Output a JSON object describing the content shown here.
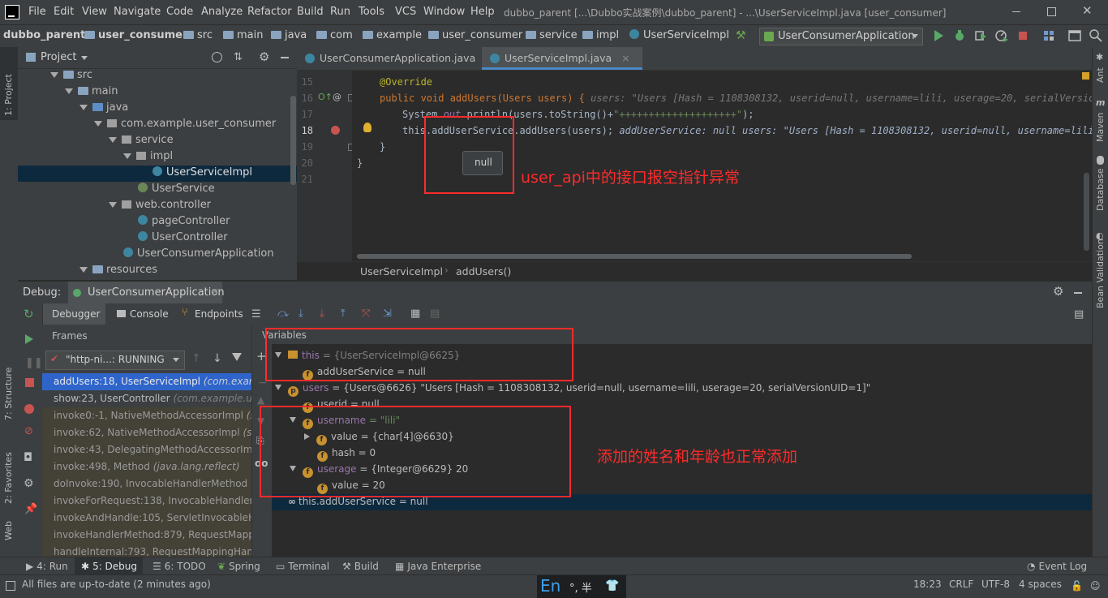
{
  "menu": {
    "items": [
      "File",
      "Edit",
      "View",
      "Navigate",
      "Code",
      "Analyze",
      "Refactor",
      "Build",
      "Run",
      "Tools",
      "VCS",
      "Window",
      "Help"
    ],
    "window_title": "dubbo_parent [...\\Dubbo实战案例\\dubbo_parent] - ...\\UserServiceImpl.java [user_consumer]"
  },
  "breadcrumbs": [
    "dubbo_parent",
    "user_consumer",
    "src",
    "main",
    "java",
    "com",
    "example",
    "user_consumer",
    "service",
    "impl",
    "UserServiceImpl"
  ],
  "run_config": "UserConsumerApplication",
  "project": {
    "title": "Project",
    "tree": [
      {
        "label": "src",
        "type": "folder"
      },
      {
        "label": "main",
        "type": "folder"
      },
      {
        "label": "java",
        "type": "folder"
      },
      {
        "label": "com.example.user_consumer",
        "type": "package"
      },
      {
        "label": "service",
        "type": "package"
      },
      {
        "label": "impl",
        "type": "package"
      },
      {
        "label": "UserServiceImpl",
        "type": "class"
      },
      {
        "label": "UserService",
        "type": "interface"
      },
      {
        "label": "web.controller",
        "type": "package"
      },
      {
        "label": "pageController",
        "type": "class"
      },
      {
        "label": "UserController",
        "type": "class"
      },
      {
        "label": "UserConsumerApplication",
        "type": "class"
      },
      {
        "label": "resources",
        "type": "folder"
      }
    ]
  },
  "editor": {
    "tabs": [
      "UserConsumerApplication.java",
      "UserServiceImpl.java"
    ],
    "line_numbers": [
      "15",
      "16",
      "17",
      "18",
      "19",
      "20",
      "21"
    ],
    "line15": "@Override",
    "line16_code": "public void addUsers(Users users) {",
    "line16_hint": "users: \"Users [Hash = 1108308132, userid=null, username=lili, userage=20, serialVersionU",
    "line17_a": "System.",
    "line17_b": "out",
    "line17_c": ".println(users.toString()+",
    "line17_str": "\"++++++++++++++++++++\"",
    "line17_d": ");",
    "line18_code": "this.addUserService.addUsers(users);",
    "line18_hint": "addUserService: null  users: \"Users [Hash = 1108308132, userid=null, username=lili,",
    "line19": "}",
    "line20": "}",
    "tooltip": "null",
    "trail": [
      "UserServiceImpl",
      "addUsers()"
    ]
  },
  "debug": {
    "label": "Debug:",
    "session": "UserConsumerApplication",
    "tabs": [
      "Debugger",
      "Console",
      "Endpoints"
    ],
    "frames_title": "Frames",
    "thread": "\"http-ni...: RUNNING",
    "frames": [
      {
        "method": "addUsers:18, UserServiceImpl",
        "pkg": "(com.exam"
      },
      {
        "method": "show:23, UserController",
        "pkg": "(com.example.us"
      },
      {
        "method": "invoke0:-1, NativeMethodAccessorImpl",
        "pkg": "(s"
      },
      {
        "method": "invoke:62, NativeMethodAccessorImpl",
        "pkg": "(s"
      },
      {
        "method": "invoke:43, DelegatingMethodAccessorImp",
        "pkg": ""
      },
      {
        "method": "invoke:498, Method",
        "pkg": "(java.lang.reflect)"
      },
      {
        "method": "doInvoke:190, InvocableHandlerMethod",
        "pkg": ""
      },
      {
        "method": "invokeForRequest:138, InvocableHandlerM",
        "pkg": ""
      },
      {
        "method": "invokeAndHandle:105, ServletInvocableHa",
        "pkg": ""
      },
      {
        "method": "invokeHandlerMethod:879, RequestMapp",
        "pkg": ""
      },
      {
        "method": "handleInternal:793, RequestMappingHand",
        "pkg": ""
      }
    ],
    "variables_title": "Variables",
    "vars": {
      "this_name": "this",
      "this_val": "= {UserServiceImpl@6625}",
      "addUserService": "addUserService = null",
      "users_name": "users",
      "users_val": "= {Users@6626} \"Users [Hash = 1108308132, userid=null, username=lili, userage=20, serialVersionUID=1]\"",
      "userid": "userid = null",
      "username_name": "username",
      "username_val": "= \"lili\"",
      "value_char": "value = {char[4]@6630}",
      "hash": "hash = 0",
      "userage_name": "userage",
      "userage_val": "= {Integer@6629} 20",
      "value_int": "value = 20",
      "watch": "this.addUserService = null"
    }
  },
  "annotations": {
    "npe_note": "user_api中的接口报空指针异常",
    "ok_note": "添加的姓名和年龄也正常添加"
  },
  "left_strip": [
    "1: Project",
    "7: Structure",
    "2: Favorites",
    "Web"
  ],
  "right_strip": [
    "Ant",
    "Maven",
    "Database",
    "Bean Validation"
  ],
  "tool_windows": [
    "4: Run",
    "5: Debug",
    "6: TODO",
    "Spring",
    "Terminal",
    "Build",
    "Java Enterprise"
  ],
  "event_log": "Event Log",
  "status": {
    "message": "All files are up-to-date (2 minutes ago)",
    "ime": "En",
    "ime_extra": "°, 半",
    "position": "18:23",
    "line_sep": "CRLF",
    "encoding": "UTF-8",
    "indent": "4 spaces"
  },
  "colors": {
    "accent": "#2d5d9e",
    "annotation_red": "#ff2b2b",
    "bg": "#2b2b2b",
    "panel": "#3c3f41"
  }
}
